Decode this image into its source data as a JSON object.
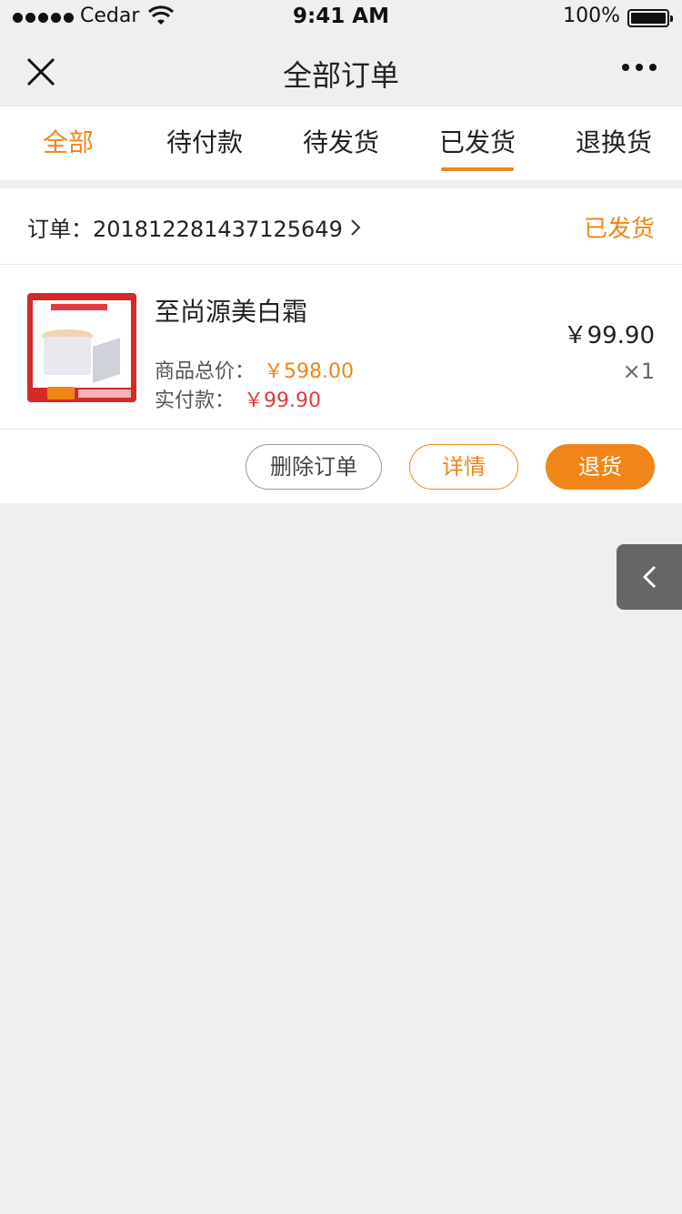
{
  "status_bar": {
    "carrier": "Cedar",
    "time": "9:41 AM",
    "battery": "100%"
  },
  "nav": {
    "title": "全部订单",
    "close_icon": "close-icon",
    "more_icon": "more-dots-icon"
  },
  "tabs": [
    {
      "label": "全部",
      "highlighted": true
    },
    {
      "label": "待付款"
    },
    {
      "label": "待发货"
    },
    {
      "label": "已发货",
      "active": true
    },
    {
      "label": "退换货"
    }
  ],
  "order": {
    "number_label": "订单：201812281437125649",
    "status": "已发货",
    "product": {
      "name": "至尚源美白霜",
      "total_label": "商品总价：",
      "total_value": "￥598.00",
      "paid_label": "实付款：",
      "paid_value": "￥99.90",
      "unit_price": "￥99.90",
      "quantity": "×1"
    },
    "actions": {
      "delete": "删除订单",
      "detail": "详情",
      "return": "退货"
    }
  },
  "colors": {
    "accent": "#f08519",
    "price_red": "#e23b3b",
    "background": "#efefef"
  }
}
